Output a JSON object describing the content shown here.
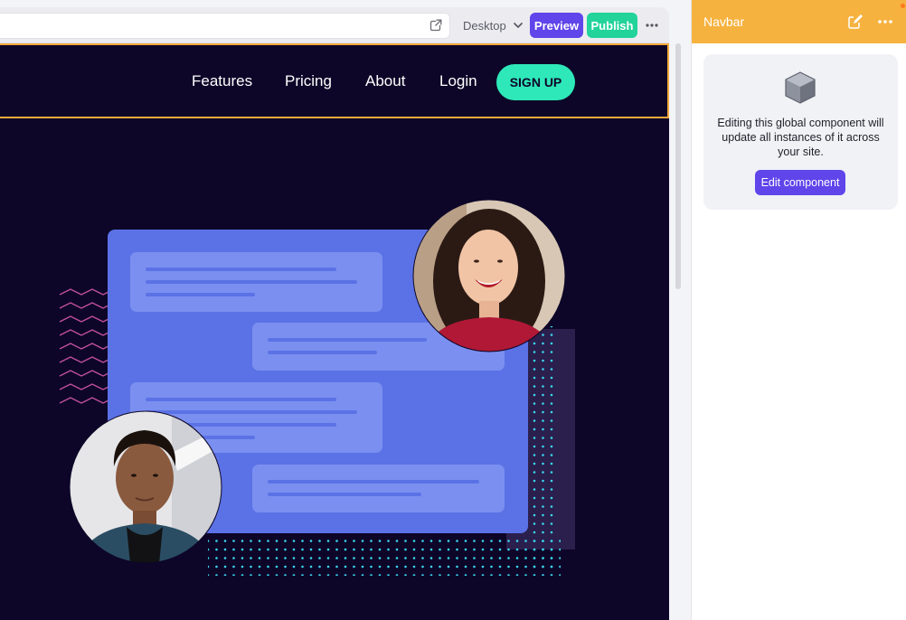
{
  "toolbar": {
    "device_label": "Desktop",
    "preview_label": "Preview",
    "publish_label": "Publish"
  },
  "site_nav": {
    "links": [
      "Features",
      "Pricing",
      "About",
      "Login"
    ],
    "cta_label": "SIGN UP"
  },
  "panel": {
    "title": "Navbar",
    "info_text": "Editing this global component will update all instances of it across your site.",
    "edit_button_label": "Edit component"
  },
  "colors": {
    "accent_purple": "#5f45ea",
    "publish_green": "#22d39a",
    "panel_header": "#f6b23f",
    "site_background": "#0d0628",
    "signup_teal": "#2ee8b9",
    "illustration_blue": "#5b72e6"
  },
  "icons": [
    "external-link-icon",
    "chevron-down-icon",
    "more-icon",
    "pencil-icon",
    "cube-icon"
  ]
}
